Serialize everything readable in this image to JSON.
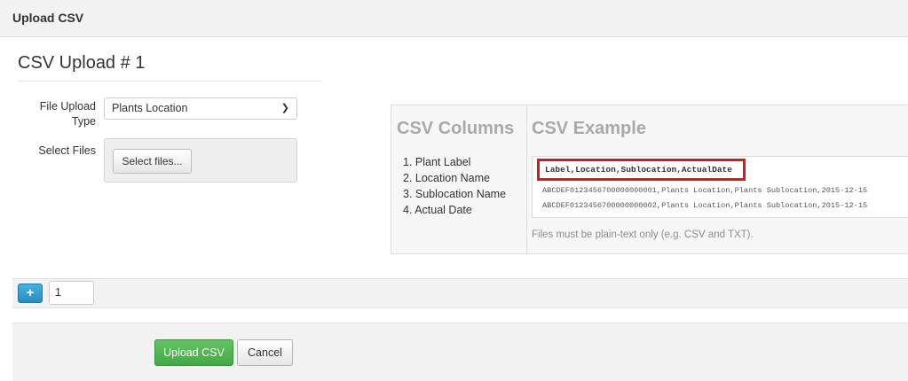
{
  "header": {
    "title": "Upload CSV"
  },
  "upload_block": {
    "title": "CSV Upload # 1",
    "file_type_label": "File Upload Type",
    "file_type_value": "Plants Location",
    "select_files_label": "Select Files",
    "select_files_button": "Select files..."
  },
  "csv_info": {
    "columns_heading": "CSV Columns",
    "example_heading": "CSV Example",
    "columns": [
      "1. Plant Label",
      "2. Location Name",
      "3. Sublocation Name",
      "4. Actual Date"
    ],
    "example_header": "Label,Location,Sublocation,ActualDate",
    "example_rows": [
      "ABCDEF0123456700000000001,Plants Location,Plants Sublocation,2015-12-15",
      "ABCDEF0123456700000000002,Plants Location,Plants Sublocation,2015-12-15"
    ],
    "note": "Files must be plain-text only (e.g. CSV and TXT).",
    "highlight_color": "#e0161a"
  },
  "counter": {
    "add_icon": "+",
    "value": "1"
  },
  "footer": {
    "upload_button": "Upload CSV",
    "cancel_button": "Cancel"
  },
  "colors": {
    "primary_blue": "#2a8bbf",
    "success_green": "#45a745",
    "panel_bg": "#f7f7f7"
  }
}
